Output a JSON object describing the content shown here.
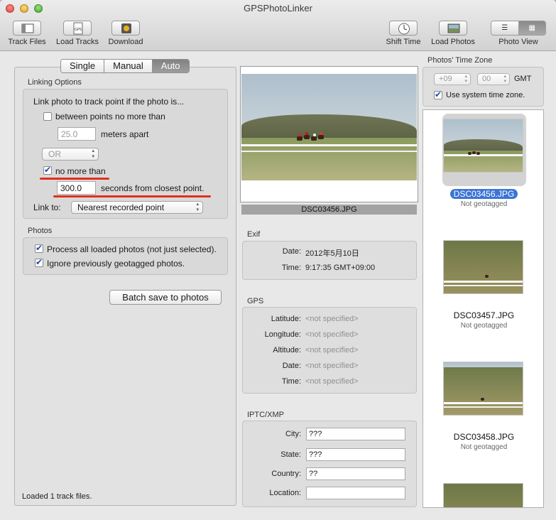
{
  "window": {
    "title": "GPSPhotoLinker"
  },
  "toolbar": {
    "track_files": "Track Files",
    "load_tracks": "Load Tracks",
    "load_tracks_badge": "GPS",
    "download": "Download",
    "shift_time": "Shift Time",
    "load_photos": "Load Photos",
    "photo_view": "Photo View",
    "photo_view_selected": "grid"
  },
  "mode_tabs": [
    "Single",
    "Manual",
    "Auto"
  ],
  "mode_selected": "Auto",
  "linking": {
    "group_title": "Linking Options",
    "intro": "Link photo to track point if the photo is...",
    "between_label": "between points no more than",
    "between_checked": false,
    "meters_value": "25.0",
    "meters_label": "meters apart",
    "or_value": "OR",
    "no_more_label": "no more than",
    "no_more_checked": true,
    "seconds_value": "300.0",
    "seconds_label": "seconds from closest point.",
    "link_to_label": "Link to:",
    "link_to_value": "Nearest recorded point"
  },
  "photos_group": {
    "title": "Photos",
    "process_all": "Process all loaded photos (not just selected).",
    "process_all_checked": true,
    "ignore_geotagged": "Ignore previously geotagged photos.",
    "ignore_geotagged_checked": true
  },
  "batch_button": "Batch save to photos",
  "status": "Loaded 1 track files.",
  "preview": {
    "caption": "DSC03456.JPG"
  },
  "exif": {
    "title": "Exif",
    "date_label": "Date:",
    "date_value": "2012年5月10日",
    "time_label": "Time:",
    "time_value": "9:17:35 GMT+09:00"
  },
  "gps": {
    "title": "GPS",
    "rows": [
      {
        "label": "Latitude:",
        "value": "<not specified>"
      },
      {
        "label": "Longitude:",
        "value": "<not specified>"
      },
      {
        "label": "Altitude:",
        "value": "<not specified>"
      },
      {
        "label": "Date:",
        "value": "<not specified>"
      },
      {
        "label": "Time:",
        "value": "<not specified>"
      }
    ]
  },
  "iptc": {
    "title": "IPTC/XMP",
    "rows": [
      {
        "label": "City:",
        "value": "???"
      },
      {
        "label": "State:",
        "value": "???"
      },
      {
        "label": "Country:",
        "value": "??"
      },
      {
        "label": "Location:",
        "value": ""
      }
    ]
  },
  "timezone": {
    "title": "Photos' Time Zone",
    "hours": "+09",
    "minutes": "00",
    "gmt": "GMT",
    "use_system_label": "Use system time zone.",
    "use_system_checked": true
  },
  "photo_list": [
    {
      "name": "DSC03456.JPG",
      "status": "Not geotagged",
      "selected": true
    },
    {
      "name": "DSC03457.JPG",
      "status": "Not geotagged",
      "selected": false
    },
    {
      "name": "DSC03458.JPG",
      "status": "Not geotagged",
      "selected": false
    }
  ],
  "colors": {
    "selection": "#3c74d6",
    "annotation_underline": "#e0301e"
  }
}
